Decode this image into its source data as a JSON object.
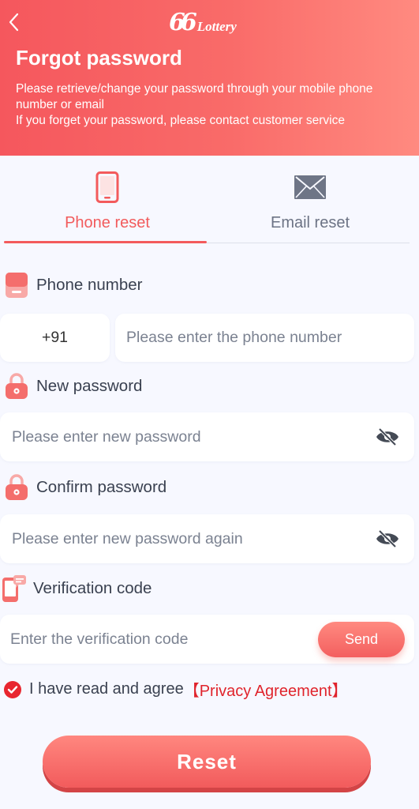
{
  "header": {
    "logo_number": "66",
    "logo_text": "Lottery",
    "title": "Forgot password",
    "description_line1": "Please retrieve/change your password through your mobile phone\nnumber or email",
    "description_line2": "If you forget your password, please contact customer service",
    "back_icon": "chevron-left-icon"
  },
  "tabs": [
    {
      "label": "Phone reset",
      "icon": "phone-icon",
      "active": true
    },
    {
      "label": "Email reset",
      "icon": "envelope-icon",
      "active": false
    }
  ],
  "form": {
    "phone_label": "Phone number",
    "country_code": "+91",
    "phone_placeholder": "Please enter the phone number",
    "new_password_label": "New password",
    "new_password_placeholder": "Please enter new password",
    "confirm_password_label": "Confirm password",
    "confirm_password_placeholder": "Please enter new password again",
    "verification_label": "Verification code",
    "verification_placeholder": "Enter the verification code",
    "send_label": "Send",
    "agree_text": "I have read and agree",
    "agree_link": "【Privacy Agreement】",
    "reset_label": "Reset"
  },
  "colors": {
    "accent": "#f35b5c",
    "link": "#e0242c",
    "background": "#f7f8ff"
  }
}
